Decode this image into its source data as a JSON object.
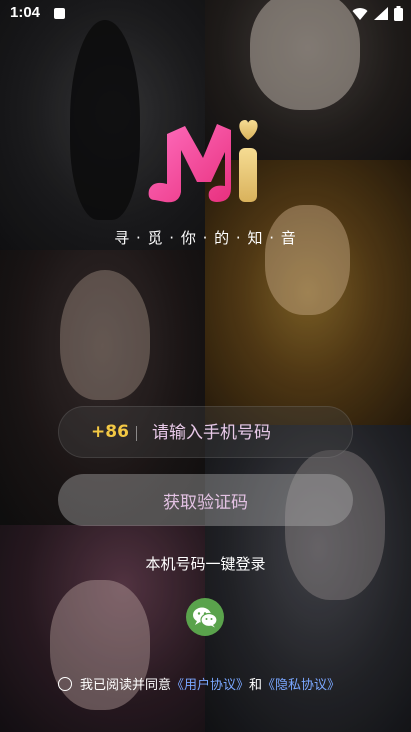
{
  "status_bar": {
    "time": "1:04",
    "icons": [
      "notification-icon",
      "wifi-icon",
      "signal-icon",
      "battery-icon"
    ]
  },
  "logo": {
    "letters": "Mi",
    "colors": {
      "pink": "#ff4fa3",
      "gold": "#e8c870"
    }
  },
  "tagline": "寻 · 觅 · 你 · 的 · 知 · 音",
  "phone": {
    "country_code": "+86",
    "placeholder": "请输入手机号码",
    "value": ""
  },
  "get_code_label": "获取验证码",
  "one_click_login": "本机号码一键登录",
  "wechat_icon": "wechat-icon",
  "agreement": {
    "prefix": "我已阅读并同意",
    "user_agreement": "《用户协议》",
    "and": "和",
    "privacy_agreement": "《隐私协议》"
  },
  "colors": {
    "accent_gold": "#f3c844",
    "link_blue": "#7aa7ff",
    "wechat_green": "#5aa34c"
  }
}
